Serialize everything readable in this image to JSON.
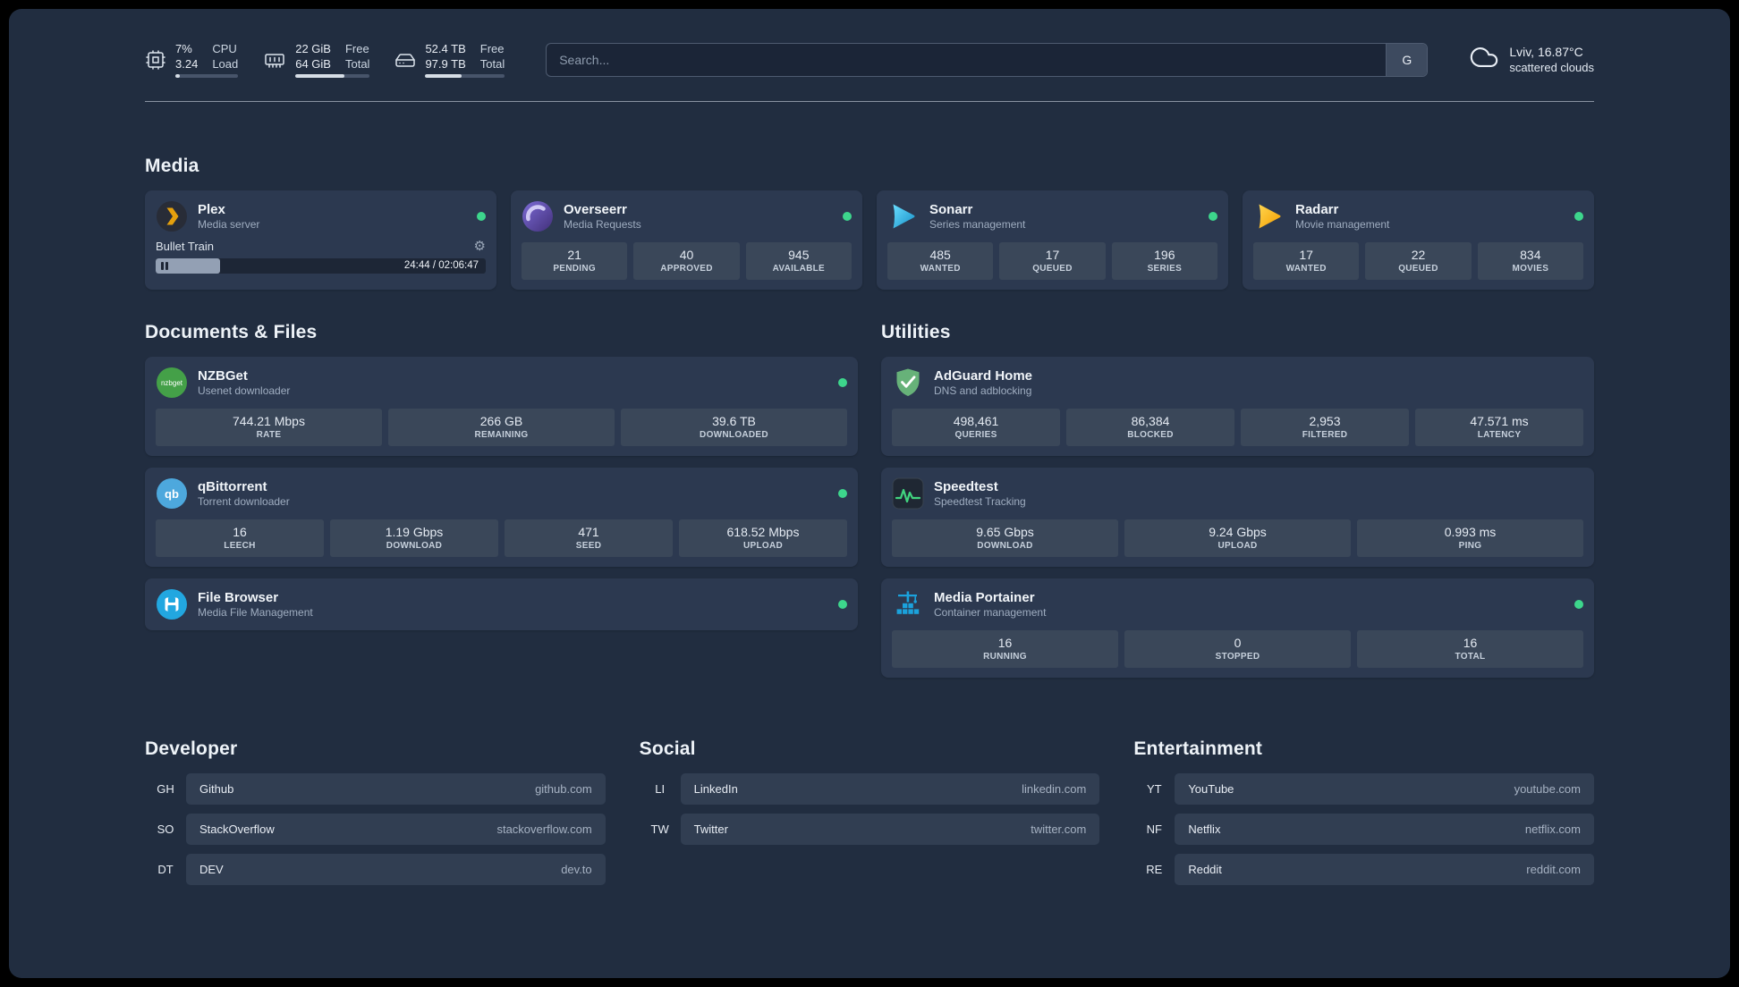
{
  "icons": {
    "gear": "⚙"
  },
  "colors": {
    "status_online": "#3dd68c",
    "accent_green": "#41d47f"
  },
  "topbar": {
    "resources": [
      {
        "v1": "7%",
        "v2": "3.24",
        "l1": "CPU",
        "l2": "Load",
        "progress": 7
      },
      {
        "v1": "22 GiB",
        "v2": "64 GiB",
        "l1": "Free",
        "l2": "Total",
        "progress": 66
      },
      {
        "v1": "52.4 TB",
        "v2": "97.9 TB",
        "l1": "Free",
        "l2": "Total",
        "progress": 46
      }
    ],
    "search": {
      "placeholder": "Search...",
      "provider_label": "G"
    },
    "weather": {
      "location": "Lviv, 16.87°C",
      "condition": "scattered clouds"
    }
  },
  "media": {
    "title": "Media",
    "plex": {
      "name": "Plex",
      "desc": "Media server",
      "now_playing": "Bullet Train",
      "time": "24:44 / 02:06:47",
      "progress": 19.5
    },
    "overseerr": {
      "name": "Overseerr",
      "desc": "Media Requests",
      "stats": [
        {
          "v": "21",
          "l": "PENDING"
        },
        {
          "v": "40",
          "l": "APPROVED"
        },
        {
          "v": "945",
          "l": "AVAILABLE"
        }
      ]
    },
    "sonarr": {
      "name": "Sonarr",
      "desc": "Series management",
      "stats": [
        {
          "v": "485",
          "l": "WANTED"
        },
        {
          "v": "17",
          "l": "QUEUED"
        },
        {
          "v": "196",
          "l": "SERIES"
        }
      ]
    },
    "radarr": {
      "name": "Radarr",
      "desc": "Movie management",
      "stats": [
        {
          "v": "17",
          "l": "WANTED"
        },
        {
          "v": "22",
          "l": "QUEUED"
        },
        {
          "v": "834",
          "l": "MOVIES"
        }
      ]
    }
  },
  "documents": {
    "title": "Documents & Files",
    "nzbget": {
      "name": "NZBGet",
      "desc": "Usenet downloader",
      "stats": [
        {
          "v": "744.21 Mbps",
          "l": "RATE"
        },
        {
          "v": "266 GB",
          "l": "REMAINING"
        },
        {
          "v": "39.6 TB",
          "l": "DOWNLOADED"
        }
      ]
    },
    "qbittorrent": {
      "name": "qBittorrent",
      "desc": "Torrent downloader",
      "stats": [
        {
          "v": "16",
          "l": "LEECH"
        },
        {
          "v": "1.19 Gbps",
          "l": "DOWNLOAD"
        },
        {
          "v": "471",
          "l": "SEED"
        },
        {
          "v": "618.52 Mbps",
          "l": "UPLOAD"
        }
      ]
    },
    "filebrowser": {
      "name": "File Browser",
      "desc": "Media File Management"
    }
  },
  "utilities": {
    "title": "Utilities",
    "adguard": {
      "name": "AdGuard Home",
      "desc": "DNS and adblocking",
      "stats": [
        {
          "v": "498,461",
          "l": "QUERIES"
        },
        {
          "v": "86,384",
          "l": "BLOCKED"
        },
        {
          "v": "2,953",
          "l": "FILTERED"
        },
        {
          "v": "47.571 ms",
          "l": "LATENCY"
        }
      ]
    },
    "speedtest": {
      "name": "Speedtest",
      "desc": "Speedtest Tracking",
      "stats": [
        {
          "v": "9.65 Gbps",
          "l": "DOWNLOAD"
        },
        {
          "v": "9.24 Gbps",
          "l": "UPLOAD"
        },
        {
          "v": "0.993 ms",
          "l": "PING"
        }
      ]
    },
    "portainer": {
      "name": "Media Portainer",
      "desc": "Container management",
      "stats": [
        {
          "v": "16",
          "l": "RUNNING"
        },
        {
          "v": "0",
          "l": "STOPPED"
        },
        {
          "v": "16",
          "l": "TOTAL"
        }
      ]
    }
  },
  "bookmarks": [
    {
      "title": "Developer",
      "items": [
        {
          "abbr": "GH",
          "name": "Github",
          "url": "github.com"
        },
        {
          "abbr": "SO",
          "name": "StackOverflow",
          "url": "stackoverflow.com"
        },
        {
          "abbr": "DT",
          "name": "DEV",
          "url": "dev.to"
        }
      ]
    },
    {
      "title": "Social",
      "items": [
        {
          "abbr": "LI",
          "name": "LinkedIn",
          "url": "linkedin.com"
        },
        {
          "abbr": "TW",
          "name": "Twitter",
          "url": "twitter.com"
        }
      ]
    },
    {
      "title": "Entertainment",
      "items": [
        {
          "abbr": "YT",
          "name": "YouTube",
          "url": "youtube.com"
        },
        {
          "abbr": "NF",
          "name": "Netflix",
          "url": "netflix.com"
        },
        {
          "abbr": "RE",
          "name": "Reddit",
          "url": "reddit.com"
        }
      ]
    }
  ]
}
